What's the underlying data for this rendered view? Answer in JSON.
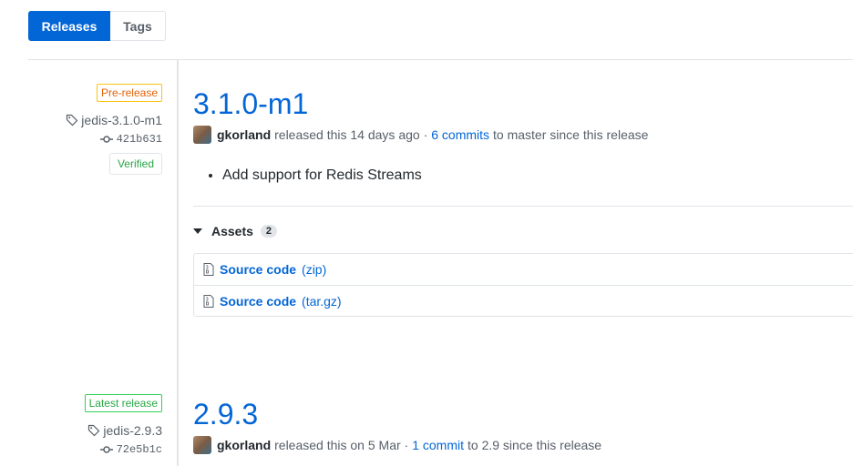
{
  "tabs": {
    "releases": "Releases",
    "tags": "Tags"
  },
  "releases": [
    {
      "badge": "Pre-release",
      "tag": "jedis-3.1.0-m1",
      "commit": "421b631",
      "verified": "Verified",
      "title": "3.1.0-m1",
      "author": "gkorland",
      "released_text": "released this 14 days ago ·",
      "commits_link": "6 commits",
      "branch_text": "to master since this release",
      "notes": [
        "Add support for Redis Streams"
      ],
      "assets_label": "Assets",
      "assets_count": "2",
      "assets": [
        {
          "name": "Source code",
          "type": "(zip)"
        },
        {
          "name": "Source code",
          "type": "(tar.gz)"
        }
      ]
    },
    {
      "badge": "Latest release",
      "tag": "jedis-2.9.3",
      "commit": "72e5b1c",
      "title": "2.9.3",
      "author": "gkorland",
      "released_text": "released this on 5 Mar ·",
      "commits_link": "1 commit",
      "branch_text": "to 2.9 since this release"
    }
  ],
  "colors": {
    "accent": "#0366d6",
    "prerelease": "#e36209",
    "latest": "#28a745"
  },
  "icons": [
    "tag-icon",
    "commit-icon",
    "file-zip-icon",
    "triangle-down-icon"
  ]
}
